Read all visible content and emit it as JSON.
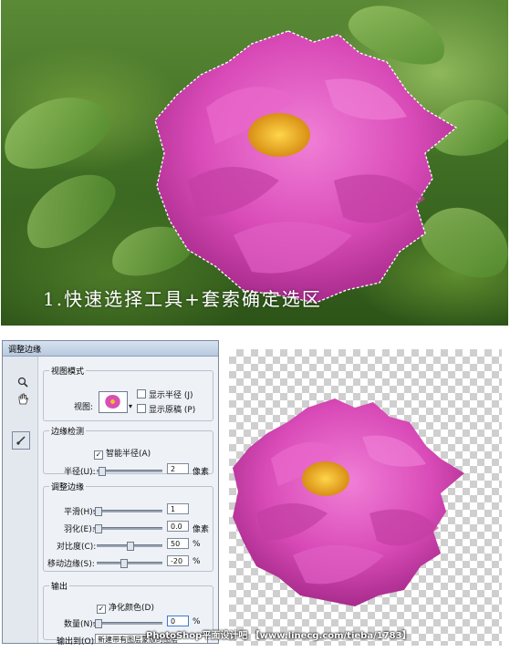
{
  "photo": {
    "caption": "1.快速选择工具+套索确定选区"
  },
  "dialog": {
    "title": "调整边缘",
    "view_mode": {
      "legend": "视图模式",
      "view_label": "视图:",
      "show_radius": "显示半径 (J)",
      "show_original": "显示原稿 (P)"
    },
    "edge_detection": {
      "legend": "边缘检测",
      "smart_radius": "智能半径(A)",
      "smart_radius_checked": true,
      "radius_label": "半径(U):",
      "radius_value": "2",
      "radius_unit": "像素"
    },
    "adjust_edge": {
      "legend": "调整边缘",
      "smooth_label": "平滑(H):",
      "smooth_value": "1",
      "feather_label": "羽化(E):",
      "feather_value": "0.0",
      "feather_unit": "像素",
      "contrast_label": "对比度(C):",
      "contrast_value": "50",
      "contrast_unit": "%",
      "shift_label": "移动边缘(S):",
      "shift_value": "-20",
      "shift_unit": "%"
    },
    "output": {
      "legend": "输出",
      "decontaminate": "净化颜色(D)",
      "decontaminate_checked": true,
      "amount_label": "数量(N):",
      "amount_value": "0",
      "amount_unit": "%",
      "output_to_label": "输出到(O):",
      "output_to_value": "新建带有图层蒙版的图层"
    }
  },
  "footer": {
    "watermark": "PhotoShop平面设计吧  【www.linecg.com/tieba/1783】"
  },
  "colors": {
    "flower": "#d94bb8",
    "flower_center": "#f2b320",
    "leaf": "#5b8a36"
  }
}
